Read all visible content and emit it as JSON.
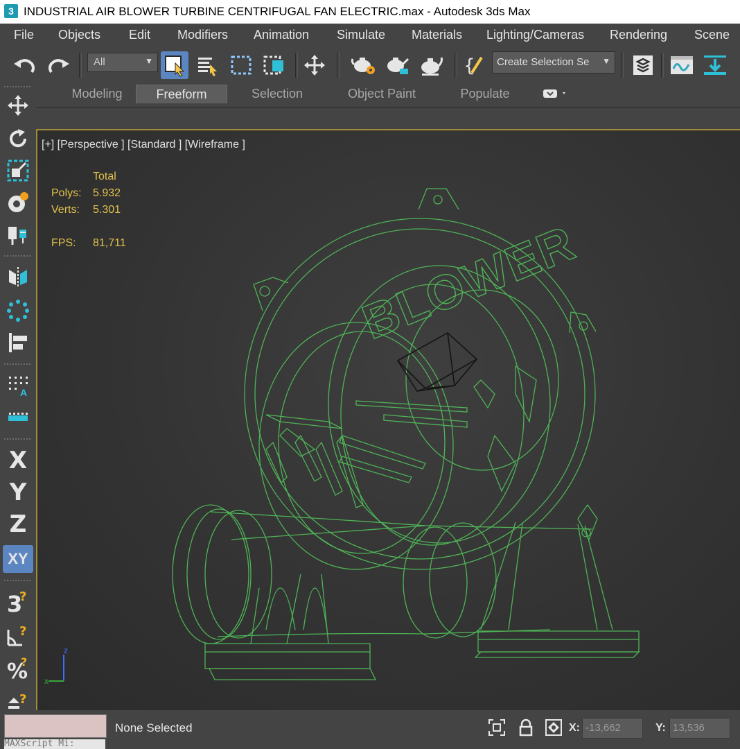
{
  "window": {
    "app_icon": "3",
    "title": "INDUSTRIAL AIR BLOWER TURBINE CENTRIFUGAL FAN ELECTRIC.max - Autodesk 3ds Max"
  },
  "menu": [
    "File",
    "Objects",
    "Edit",
    "Modifiers",
    "Animation",
    "Simulate",
    "Materials",
    "Lighting/Cameras",
    "Rendering",
    "Scene"
  ],
  "toolbar": {
    "filter_value": "All",
    "selection_set_value": "Create Selection Se",
    "icons": [
      "undo-icon",
      "redo-icon",
      "select-object-icon",
      "select-by-name-icon",
      "rectangular-selection-icon",
      "window-crossing-icon",
      "move-icon",
      "render-setup-icon",
      "rendered-frame-icon",
      "render-icon",
      "edit-named-selection-icon",
      "layer-explorer-icon",
      "curve-editor-icon",
      "toggle-ribbon-icon"
    ]
  },
  "ribbon": {
    "tabs": [
      "Modeling",
      "Freeform",
      "Selection",
      "Object Paint",
      "Populate"
    ],
    "active_tab": "Freeform"
  },
  "left_tools": {
    "axis_labels": [
      "X",
      "Y",
      "Z",
      "XY"
    ],
    "active_axis": "XY",
    "icons": [
      "move-icon",
      "rotate-icon",
      "scale-icon",
      "place-icon",
      "snap-icon",
      "mirror-icon",
      "array-icon",
      "align-icon",
      "spacing-icon",
      "clone-icon",
      "snaps-toggle-icon",
      "angle-snap-icon",
      "percent-snap-icon",
      "spinner-snap-icon"
    ]
  },
  "viewport": {
    "label": "[+] [Perspective ] [Standard ] [Wireframe ]",
    "stats": {
      "header": "Total",
      "polys_label": "Polys:",
      "polys_value": "5.932",
      "verts_label": "Verts:",
      "verts_value": "5.301",
      "fps_label": "FPS:",
      "fps_value": "81,711"
    },
    "model_text": "BLOWER",
    "gizmo_labels": {
      "z": "z",
      "x": "x"
    },
    "wire_color": "#4fb356",
    "border_color": "#a08c36"
  },
  "status": {
    "maxscript_text": "MAXScript Mi:",
    "selection": "None Selected",
    "x_label": "X:",
    "x_value": "-13,662",
    "y_label": "Y:",
    "y_value": "13,536",
    "icons": [
      "isolate-selection-icon",
      "lock-icon",
      "absolute-mode-icon"
    ]
  }
}
